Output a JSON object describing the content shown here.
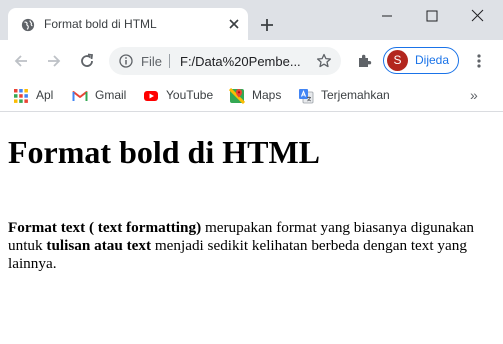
{
  "window": {
    "tab_title": "Format bold di HTML"
  },
  "toolbar": {
    "scheme": "File",
    "url": "F:/Data%20Pembe...",
    "profile_initial": "S",
    "profile_name": "Dijeda"
  },
  "bookmarks": [
    {
      "label": "Apl",
      "icon": "apps-grid-icon"
    },
    {
      "label": "Gmail",
      "icon": "gmail-icon"
    },
    {
      "label": "YouTube",
      "icon": "youtube-icon"
    },
    {
      "label": "Maps",
      "icon": "maps-icon"
    },
    {
      "label": "Terjemahkan",
      "icon": "translate-icon"
    }
  ],
  "bookmarks_more": "»",
  "page": {
    "title": "Format bold di HTML",
    "paragraph": {
      "bold1": "Format text ( text formatting)",
      "text1": " merupakan format yang biasanya digunakan untuk ",
      "bold2": "tulisan atau text",
      "text2": " menjadi sedikit kelihatan berbeda dengan text yang lainnya."
    }
  },
  "colors": {
    "tabstrip_bg": "#dee1e6",
    "accent_blue": "#1a73e8",
    "avatar_red": "#b3261e",
    "youtube_red": "#ff0000"
  }
}
